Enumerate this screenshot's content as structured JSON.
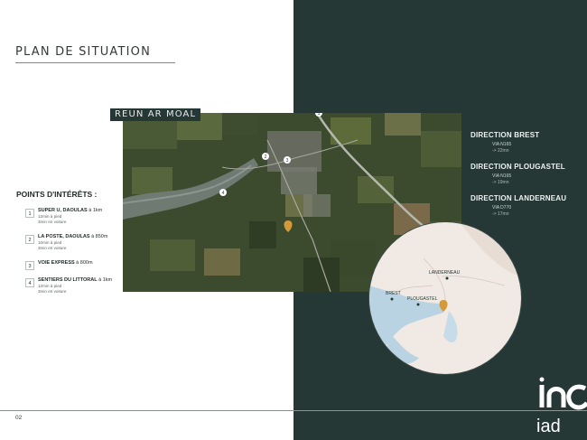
{
  "header": {
    "title": "PLAN DE SITUATION"
  },
  "map_label": "REUN AR MOAL",
  "points_of_interest": {
    "heading": "POINTS D'INTÉRÊTS :",
    "items": [
      {
        "number": "1",
        "name": "SUPER U, DAOULAS",
        "distance": " à 1km",
        "detail1": "12min à pied",
        "detail2": "3min en voiture"
      },
      {
        "number": "2",
        "name": "LA POSTE, DAOULAS",
        "distance": " à 850m",
        "detail1": "10min à pied",
        "detail2": "3min en voiture"
      },
      {
        "number": "3",
        "name": "VOIE EXPRESS",
        "distance": " à 800m",
        "detail1": "",
        "detail2": ""
      },
      {
        "number": "4",
        "name": "SENTIERS DU LITTORAL",
        "distance": " à 1km",
        "detail1": "12min à pied",
        "detail2": "3min en voiture"
      }
    ]
  },
  "directions": [
    {
      "title": "DIRECTION BREST",
      "via": "VIA N165",
      "time": "-> 22mn"
    },
    {
      "title": "DIRECTION PLOUGASTEL",
      "via": "VIA N165",
      "time": "-> 19mn"
    },
    {
      "title": "DIRECTION LANDERNEAU",
      "via": "VIA D770",
      "time": "-> 17mn"
    }
  ],
  "circle_map_labels": {
    "landerneau": "LANDERNEAU",
    "brest": "BREST",
    "plougastel": "PLOUGASTEL"
  },
  "map_markers": [
    "1",
    "2",
    "3",
    "4"
  ],
  "footer": {
    "page_number": "02"
  },
  "brand": {
    "logo_text": "iad",
    "accent_color": "#d49a3a",
    "dark_panel_color": "#263836"
  }
}
